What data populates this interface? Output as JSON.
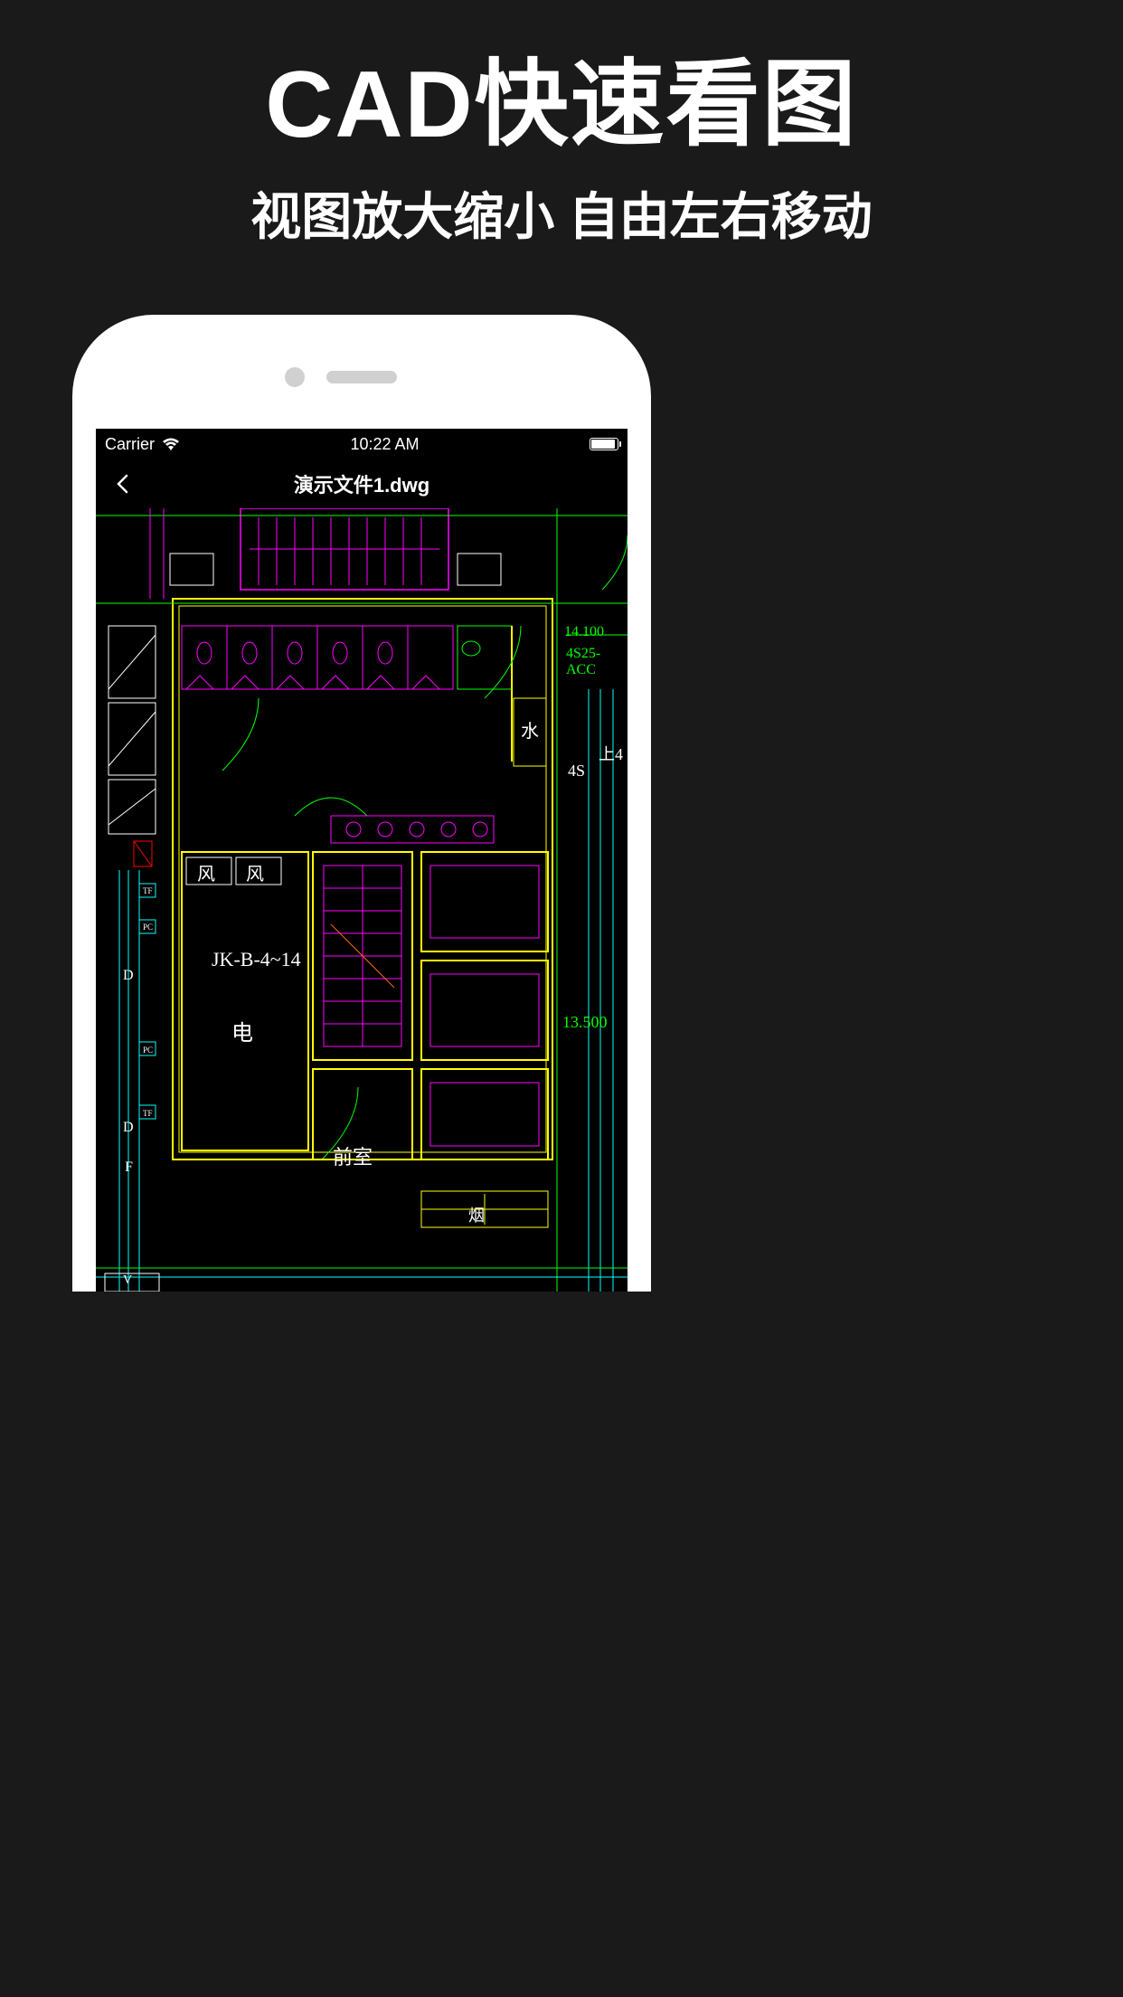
{
  "promo": {
    "title": "CAD快速看图",
    "subtitle": "视图放大缩小 自由左右移动"
  },
  "status_bar": {
    "carrier": "Carrier",
    "time": "10:22 AM"
  },
  "nav": {
    "file_title": "演示文件1.dwg"
  },
  "cad_labels": {
    "water": "水",
    "wind1": "风",
    "wind2": "风",
    "jk_code": "JK-B-4~14",
    "electric": "电",
    "front_room": "前室",
    "smoke": "烟",
    "dim_14100": "14.100",
    "beam_code": "4S25-ACC",
    "up4": "上4",
    "fs4": "4S",
    "dim_13500": "13.500",
    "d1": "D",
    "d2": "D",
    "f_label": "F",
    "pc1": "PC",
    "pc2": "PC",
    "tf1": "TF",
    "tf2": "TF",
    "v_label": "V"
  },
  "colors": {
    "magenta": "#ff00ff",
    "yellow": "#ffff00",
    "green": "#00ff00",
    "cyan": "#00ffff",
    "red": "#ff0000",
    "white": "#ffffff"
  }
}
